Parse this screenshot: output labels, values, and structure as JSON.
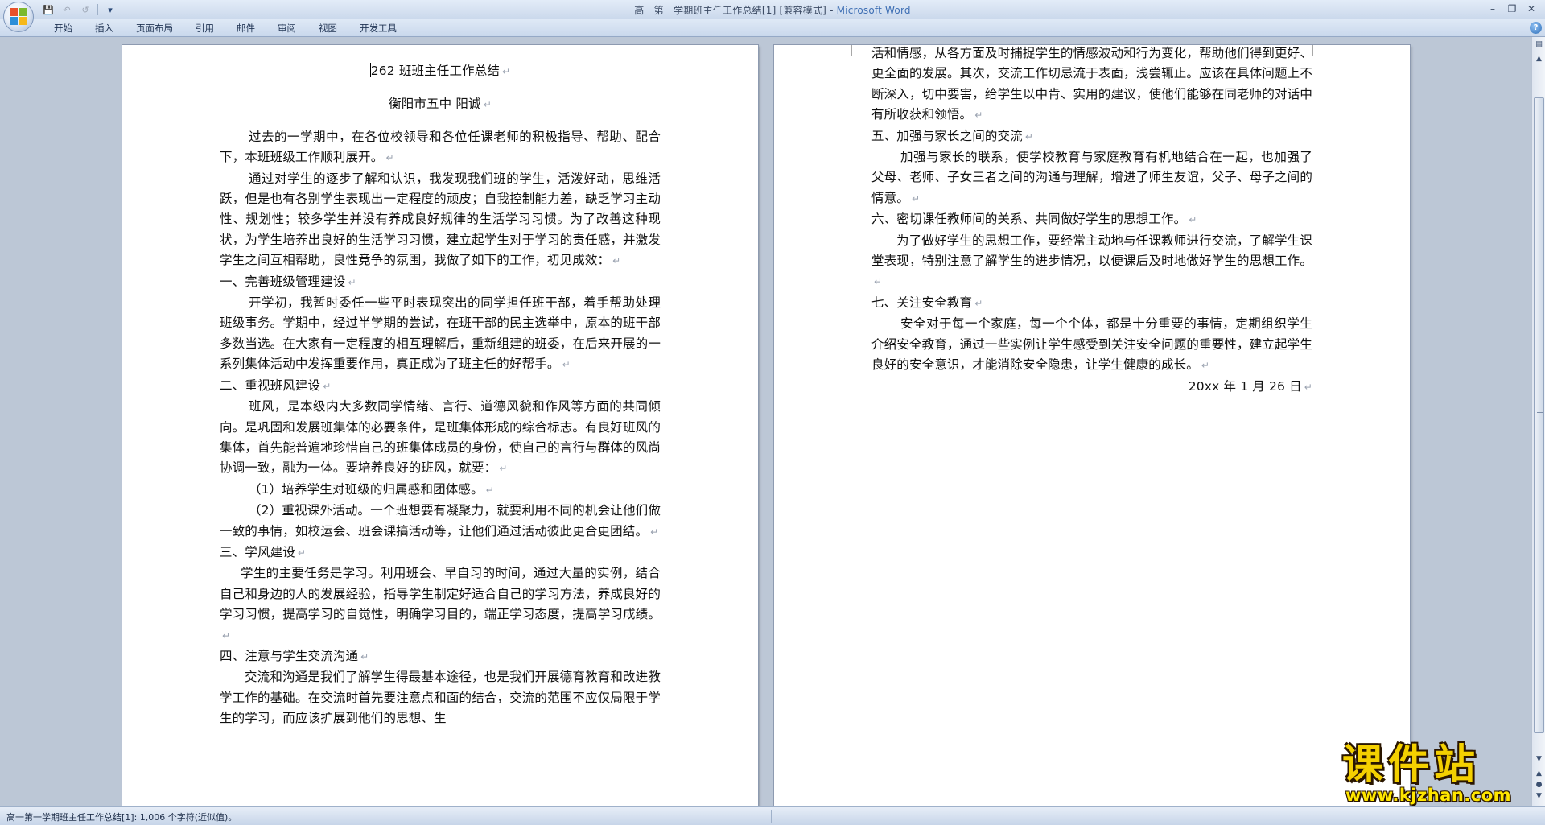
{
  "window": {
    "title_prefix": "高一第一学期班主任工作总结[1] [兼容模式] - ",
    "title_app": "Microsoft Word"
  },
  "qat": {
    "save_icon": "save-icon",
    "undo_icon": "undo-icon",
    "redo_icon": "redo-icon",
    "customize_icon": "customize-qat-icon"
  },
  "ribbon": {
    "tabs": [
      {
        "label": "开始"
      },
      {
        "label": "插入"
      },
      {
        "label": "页面布局"
      },
      {
        "label": "引用"
      },
      {
        "label": "邮件"
      },
      {
        "label": "审阅"
      },
      {
        "label": "视图"
      },
      {
        "label": "开发工具"
      }
    ]
  },
  "page1": {
    "title": "262 班班主任工作总结",
    "author": "衡阳市五中  阳诚",
    "paragraphs": [
      "过去的一学期中，在各位校领导和各位任课老师的积极指导、帮助、配合下，本班班级工作顺利展开。",
      "通过对学生的逐步了解和认识，我发现我们班的学生，活泼好动，思维活跃，但是也有各别学生表现出一定程度的顽皮；自我控制能力差，缺乏学习主动性、规划性；较多学生并没有养成良好规律的生活学习习惯。为了改善这种现状，为学生培养出良好的生活学习习惯，建立起学生对于学习的责任感，并激发学生之间互相帮助，良性竞争的氛围，我做了如下的工作，初见成效：",
      "一、完善班级管理建设",
      "开学初，我暂时委任一些平时表现突出的同学担任班干部，着手帮助处理班级事务。学期中，经过半学期的尝试，在班干部的民主选举中，原本的班干部多数当选。在大家有一定程度的相互理解后，重新组建的班委，在后来开展的一系列集体活动中发挥重要作用，真正成为了班主任的好帮手。",
      "二、重视班风建设",
      "班风，是本级内大多数同学情绪、言行、道德风貌和作风等方面的共同倾向。是巩固和发展班集体的必要条件，是班集体形成的综合标志。有良好班风的集体，首先能普遍地珍惜自己的班集体成员的身份，使自己的言行与群体的风尚协调一致，融为一体。要培养良好的班风，就要：",
      "（1）培养学生对班级的归属感和团体感。",
      "（2）重视课外活动。一个班想要有凝聚力，就要利用不同的机会让他们做一致的事情，如校运会、班会课搞活动等，让他们通过活动彼此更合更团结。",
      "三、学风建设",
      "学生的主要任务是学习。利用班会、早自习的时间，通过大量的实例，结合自己和身边的人的发展经验，指导学生制定好适合自己的学习方法，养成良好的学习习惯，提高学习的自觉性，明确学习目的，端正学习态度，提高学习成绩。",
      "四、注意与学生交流沟通",
      "交流和沟通是我们了解学生得最基本途径，也是我们开展德育教育和改进教学工作的基础。在交流时首先要注意点和面的结合，交流的范围不应仅局限于学生的学习，而应该扩展到他们的思想、生"
    ]
  },
  "page2": {
    "paragraphs": [
      "活和情感，从各方面及时捕捉学生的情感波动和行为变化，帮助他们得到更好、更全面的发展。其次，交流工作切忌流于表面，浅尝辄止。应该在具体问题上不断深入，切中要害，给学生以中肯、实用的建议，使他们能够在同老师的对话中有所收获和领悟。",
      "五、加强与家长之间的交流",
      "加强与家长的联系，使学校教育与家庭教育有机地结合在一起，也加强了父母、老师、子女三者之间的沟通与理解，增进了师生友谊，父子、母子之间的情意。",
      "六、密切课任教师间的关系、共同做好学生的思想工作。",
      "为了做好学生的思想工作，要经常主动地与任课教师进行交流，了解学生课堂表现，特别注意了解学生的进步情况，以便课后及时地做好学生的思想工作。",
      "七、关注安全教育",
      "安全对于每一个家庭，每一个个体，都是十分重要的事情，定期组织学生介绍安全教育，通过一些实例让学生感受到关注安全问题的重要性，建立起学生良好的安全意识，才能消除安全隐患，让学生健康的成长。"
    ],
    "date": "20xx 年 1 月 26 日"
  },
  "status": {
    "text": "高一第一学期班主任工作总结[1]: 1,006 个字符(近似值)。"
  },
  "watermark": {
    "top": "课件站",
    "bottom": "www.kjzhan.com"
  },
  "mark": "↵"
}
